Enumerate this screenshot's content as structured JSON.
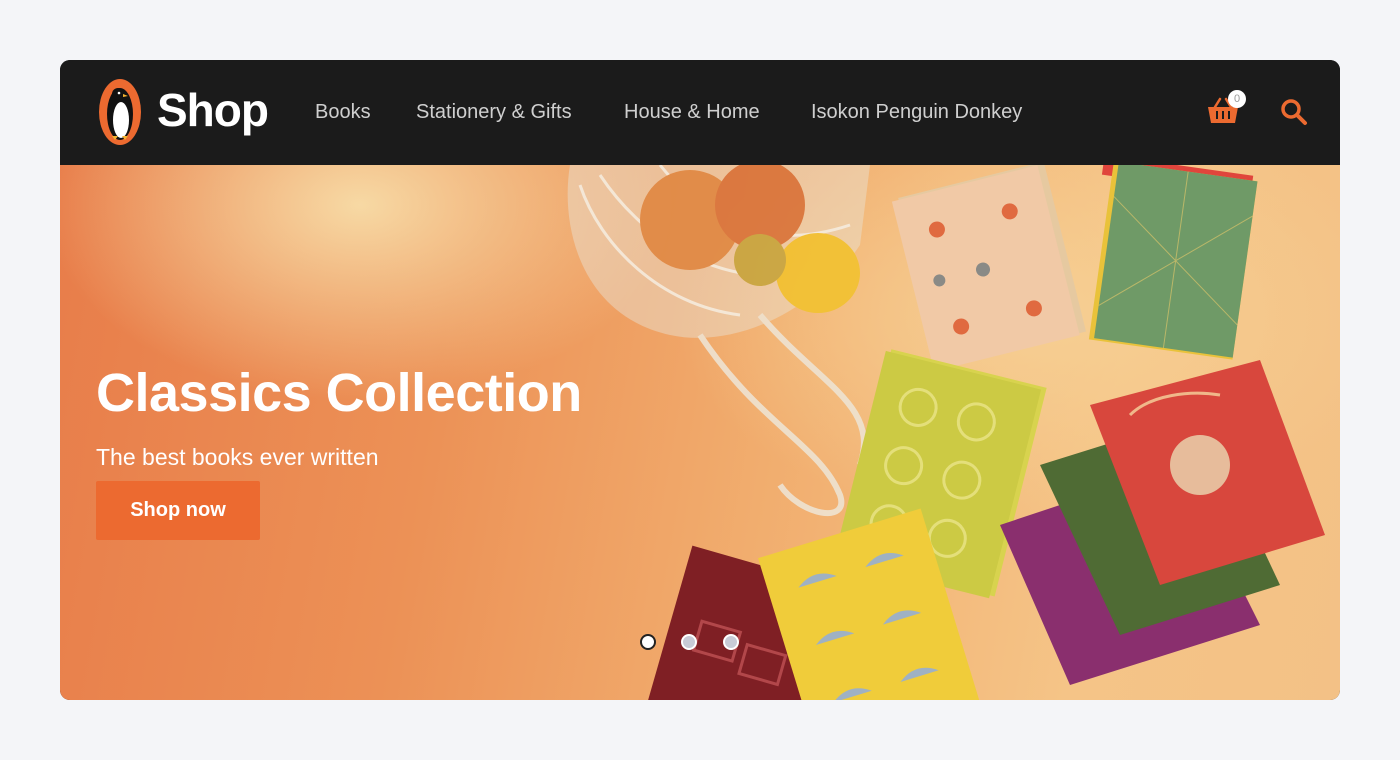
{
  "brand": {
    "name": "Shop",
    "logo_icon": "penguin-logo-icon",
    "accent": "#ec6a30"
  },
  "nav": {
    "items": [
      {
        "label": "Books"
      },
      {
        "label": "Stationery & Gifts"
      },
      {
        "label": "House & Home"
      },
      {
        "label": "Isokon Penguin Donkey"
      }
    ]
  },
  "cart": {
    "count": "0",
    "icon": "basket-icon"
  },
  "search": {
    "icon": "search-icon"
  },
  "hero": {
    "title": "Classics Collection",
    "subtitle": "The best books ever written",
    "cta_label": "Shop now",
    "slides_total": 3,
    "active_slide": 1
  }
}
